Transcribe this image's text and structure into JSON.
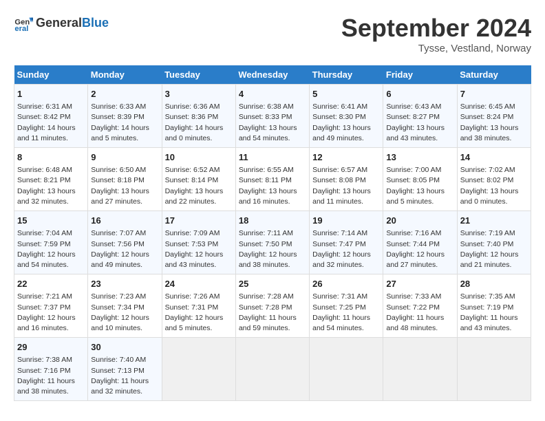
{
  "header": {
    "logo_general": "General",
    "logo_blue": "Blue",
    "month_title": "September 2024",
    "location": "Tysse, Vestland, Norway"
  },
  "days_of_week": [
    "Sunday",
    "Monday",
    "Tuesday",
    "Wednesday",
    "Thursday",
    "Friday",
    "Saturday"
  ],
  "weeks": [
    [
      {
        "day": "1",
        "sunrise": "Sunrise: 6:31 AM",
        "sunset": "Sunset: 8:42 PM",
        "daylight": "Daylight: 14 hours and 11 minutes."
      },
      {
        "day": "2",
        "sunrise": "Sunrise: 6:33 AM",
        "sunset": "Sunset: 8:39 PM",
        "daylight": "Daylight: 14 hours and 5 minutes."
      },
      {
        "day": "3",
        "sunrise": "Sunrise: 6:36 AM",
        "sunset": "Sunset: 8:36 PM",
        "daylight": "Daylight: 14 hours and 0 minutes."
      },
      {
        "day": "4",
        "sunrise": "Sunrise: 6:38 AM",
        "sunset": "Sunset: 8:33 PM",
        "daylight": "Daylight: 13 hours and 54 minutes."
      },
      {
        "day": "5",
        "sunrise": "Sunrise: 6:41 AM",
        "sunset": "Sunset: 8:30 PM",
        "daylight": "Daylight: 13 hours and 49 minutes."
      },
      {
        "day": "6",
        "sunrise": "Sunrise: 6:43 AM",
        "sunset": "Sunset: 8:27 PM",
        "daylight": "Daylight: 13 hours and 43 minutes."
      },
      {
        "day": "7",
        "sunrise": "Sunrise: 6:45 AM",
        "sunset": "Sunset: 8:24 PM",
        "daylight": "Daylight: 13 hours and 38 minutes."
      }
    ],
    [
      {
        "day": "8",
        "sunrise": "Sunrise: 6:48 AM",
        "sunset": "Sunset: 8:21 PM",
        "daylight": "Daylight: 13 hours and 32 minutes."
      },
      {
        "day": "9",
        "sunrise": "Sunrise: 6:50 AM",
        "sunset": "Sunset: 8:18 PM",
        "daylight": "Daylight: 13 hours and 27 minutes."
      },
      {
        "day": "10",
        "sunrise": "Sunrise: 6:52 AM",
        "sunset": "Sunset: 8:14 PM",
        "daylight": "Daylight: 13 hours and 22 minutes."
      },
      {
        "day": "11",
        "sunrise": "Sunrise: 6:55 AM",
        "sunset": "Sunset: 8:11 PM",
        "daylight": "Daylight: 13 hours and 16 minutes."
      },
      {
        "day": "12",
        "sunrise": "Sunrise: 6:57 AM",
        "sunset": "Sunset: 8:08 PM",
        "daylight": "Daylight: 13 hours and 11 minutes."
      },
      {
        "day": "13",
        "sunrise": "Sunrise: 7:00 AM",
        "sunset": "Sunset: 8:05 PM",
        "daylight": "Daylight: 13 hours and 5 minutes."
      },
      {
        "day": "14",
        "sunrise": "Sunrise: 7:02 AM",
        "sunset": "Sunset: 8:02 PM",
        "daylight": "Daylight: 13 hours and 0 minutes."
      }
    ],
    [
      {
        "day": "15",
        "sunrise": "Sunrise: 7:04 AM",
        "sunset": "Sunset: 7:59 PM",
        "daylight": "Daylight: 12 hours and 54 minutes."
      },
      {
        "day": "16",
        "sunrise": "Sunrise: 7:07 AM",
        "sunset": "Sunset: 7:56 PM",
        "daylight": "Daylight: 12 hours and 49 minutes."
      },
      {
        "day": "17",
        "sunrise": "Sunrise: 7:09 AM",
        "sunset": "Sunset: 7:53 PM",
        "daylight": "Daylight: 12 hours and 43 minutes."
      },
      {
        "day": "18",
        "sunrise": "Sunrise: 7:11 AM",
        "sunset": "Sunset: 7:50 PM",
        "daylight": "Daylight: 12 hours and 38 minutes."
      },
      {
        "day": "19",
        "sunrise": "Sunrise: 7:14 AM",
        "sunset": "Sunset: 7:47 PM",
        "daylight": "Daylight: 12 hours and 32 minutes."
      },
      {
        "day": "20",
        "sunrise": "Sunrise: 7:16 AM",
        "sunset": "Sunset: 7:44 PM",
        "daylight": "Daylight: 12 hours and 27 minutes."
      },
      {
        "day": "21",
        "sunrise": "Sunrise: 7:19 AM",
        "sunset": "Sunset: 7:40 PM",
        "daylight": "Daylight: 12 hours and 21 minutes."
      }
    ],
    [
      {
        "day": "22",
        "sunrise": "Sunrise: 7:21 AM",
        "sunset": "Sunset: 7:37 PM",
        "daylight": "Daylight: 12 hours and 16 minutes."
      },
      {
        "day": "23",
        "sunrise": "Sunrise: 7:23 AM",
        "sunset": "Sunset: 7:34 PM",
        "daylight": "Daylight: 12 hours and 10 minutes."
      },
      {
        "day": "24",
        "sunrise": "Sunrise: 7:26 AM",
        "sunset": "Sunset: 7:31 PM",
        "daylight": "Daylight: 12 hours and 5 minutes."
      },
      {
        "day": "25",
        "sunrise": "Sunrise: 7:28 AM",
        "sunset": "Sunset: 7:28 PM",
        "daylight": "Daylight: 11 hours and 59 minutes."
      },
      {
        "day": "26",
        "sunrise": "Sunrise: 7:31 AM",
        "sunset": "Sunset: 7:25 PM",
        "daylight": "Daylight: 11 hours and 54 minutes."
      },
      {
        "day": "27",
        "sunrise": "Sunrise: 7:33 AM",
        "sunset": "Sunset: 7:22 PM",
        "daylight": "Daylight: 11 hours and 48 minutes."
      },
      {
        "day": "28",
        "sunrise": "Sunrise: 7:35 AM",
        "sunset": "Sunset: 7:19 PM",
        "daylight": "Daylight: 11 hours and 43 minutes."
      }
    ],
    [
      {
        "day": "29",
        "sunrise": "Sunrise: 7:38 AM",
        "sunset": "Sunset: 7:16 PM",
        "daylight": "Daylight: 11 hours and 38 minutes."
      },
      {
        "day": "30",
        "sunrise": "Sunrise: 7:40 AM",
        "sunset": "Sunset: 7:13 PM",
        "daylight": "Daylight: 11 hours and 32 minutes."
      },
      {
        "day": "",
        "sunrise": "",
        "sunset": "",
        "daylight": ""
      },
      {
        "day": "",
        "sunrise": "",
        "sunset": "",
        "daylight": ""
      },
      {
        "day": "",
        "sunrise": "",
        "sunset": "",
        "daylight": ""
      },
      {
        "day": "",
        "sunrise": "",
        "sunset": "",
        "daylight": ""
      },
      {
        "day": "",
        "sunrise": "",
        "sunset": "",
        "daylight": ""
      }
    ]
  ]
}
